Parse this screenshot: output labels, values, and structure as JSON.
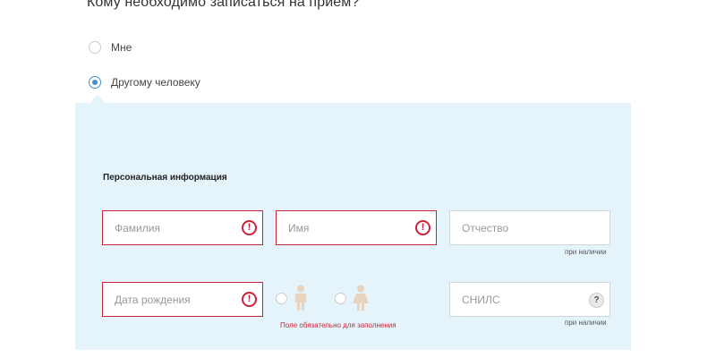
{
  "question": "Кому необходимо записаться на прием?",
  "options": [
    {
      "label": "Мне",
      "checked": false
    },
    {
      "label": "Другому человеку",
      "checked": true
    }
  ],
  "section_title": "Персональная информация",
  "fields": {
    "last_name": {
      "placeholder": "Фамилия",
      "error_icon": "!"
    },
    "first_name": {
      "placeholder": "Имя",
      "error_icon": "!"
    },
    "patronymic": {
      "placeholder": "Отчество",
      "hint": "при наличии"
    },
    "birth_date": {
      "placeholder": "Дата рождения",
      "error_icon": "!"
    },
    "snils": {
      "placeholder": "СНИЛС",
      "help_icon": "?",
      "hint": "при наличии"
    }
  },
  "gender": {
    "options": [
      {
        "icon": "male-person-icon"
      },
      {
        "icon": "female-person-icon"
      }
    ],
    "icon_color": "#e8d3bf"
  },
  "required_error": "Поле обязательно для заполнения",
  "colors": {
    "accent": "#4a90c8",
    "error": "#c8243a",
    "panel": "#e5f4fb"
  }
}
